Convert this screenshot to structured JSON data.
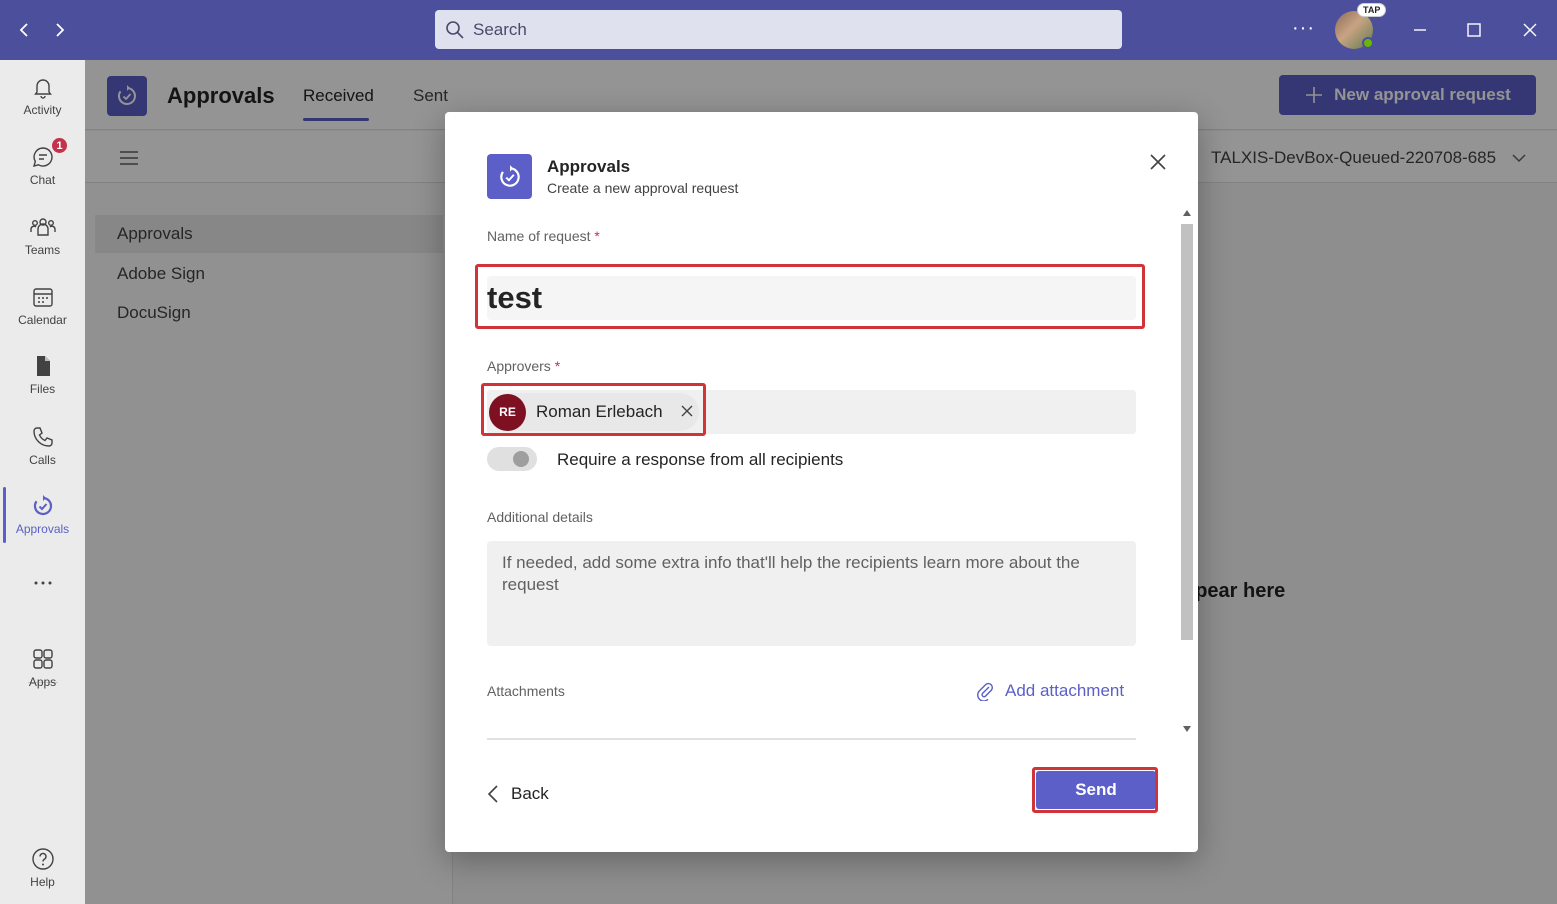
{
  "titlebar": {
    "search_placeholder": "Search",
    "more": "···",
    "avatar_badge": "TAP"
  },
  "rail": {
    "items": [
      {
        "label": "Activity",
        "icon": "bell-icon"
      },
      {
        "label": "Chat",
        "icon": "chat-icon",
        "badge": "1"
      },
      {
        "label": "Teams",
        "icon": "teams-icon"
      },
      {
        "label": "Calendar",
        "icon": "calendar-icon"
      },
      {
        "label": "Files",
        "icon": "file-icon"
      },
      {
        "label": "Calls",
        "icon": "phone-icon"
      },
      {
        "label": "Approvals",
        "icon": "approvals-icon",
        "active": true
      },
      {
        "label": "",
        "icon": "more-icon"
      },
      {
        "label": "Apps",
        "icon": "apps-icon"
      },
      {
        "label": "Help",
        "icon": "help-icon"
      }
    ]
  },
  "app": {
    "title": "Approvals",
    "tabs": [
      {
        "label": "Received",
        "active": true
      },
      {
        "label": "Sent",
        "active": false
      }
    ],
    "new_request_label": "New approval request",
    "environment": "TALXIS-DevBox-Queued-220708-685",
    "list": [
      "Approvals",
      "Adobe Sign",
      "DocuSign"
    ],
    "empty_message": "ppear here"
  },
  "dialog": {
    "title": "Approvals",
    "subtitle": "Create a new approval request",
    "name_label": "Name of request",
    "name_value": "test",
    "approvers_label": "Approvers",
    "approver": {
      "initials": "RE",
      "name": "Roman Erlebach"
    },
    "require_all_label": "Require a response from all recipients",
    "details_label": "Additional details",
    "details_placeholder": "If needed, add some extra info that'll help the recipients learn more about the request",
    "attachments_label": "Attachments",
    "add_attachment_label": "Add attachment",
    "back_label": "Back",
    "send_label": "Send",
    "required_mark": "*"
  },
  "colors": {
    "brand": "#5b5fc7",
    "titlebar": "#4b4f9c",
    "highlight": "#d13438",
    "approver_avatar": "#7e1121"
  }
}
